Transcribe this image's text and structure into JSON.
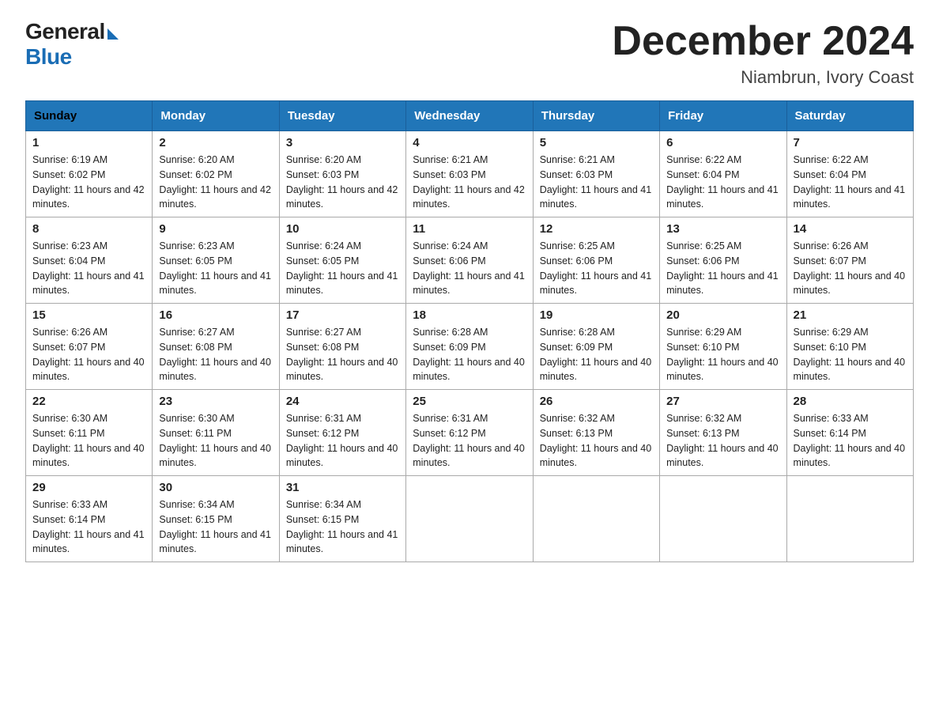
{
  "header": {
    "logo_general": "General",
    "logo_blue": "Blue",
    "month_year": "December 2024",
    "location": "Niambrun, Ivory Coast"
  },
  "days_of_week": [
    "Sunday",
    "Monday",
    "Tuesday",
    "Wednesday",
    "Thursday",
    "Friday",
    "Saturday"
  ],
  "weeks": [
    [
      {
        "day": "1",
        "sunrise": "6:19 AM",
        "sunset": "6:02 PM",
        "daylight": "11 hours and 42 minutes."
      },
      {
        "day": "2",
        "sunrise": "6:20 AM",
        "sunset": "6:02 PM",
        "daylight": "11 hours and 42 minutes."
      },
      {
        "day": "3",
        "sunrise": "6:20 AM",
        "sunset": "6:03 PM",
        "daylight": "11 hours and 42 minutes."
      },
      {
        "day": "4",
        "sunrise": "6:21 AM",
        "sunset": "6:03 PM",
        "daylight": "11 hours and 42 minutes."
      },
      {
        "day": "5",
        "sunrise": "6:21 AM",
        "sunset": "6:03 PM",
        "daylight": "11 hours and 41 minutes."
      },
      {
        "day": "6",
        "sunrise": "6:22 AM",
        "sunset": "6:04 PM",
        "daylight": "11 hours and 41 minutes."
      },
      {
        "day": "7",
        "sunrise": "6:22 AM",
        "sunset": "6:04 PM",
        "daylight": "11 hours and 41 minutes."
      }
    ],
    [
      {
        "day": "8",
        "sunrise": "6:23 AM",
        "sunset": "6:04 PM",
        "daylight": "11 hours and 41 minutes."
      },
      {
        "day": "9",
        "sunrise": "6:23 AM",
        "sunset": "6:05 PM",
        "daylight": "11 hours and 41 minutes."
      },
      {
        "day": "10",
        "sunrise": "6:24 AM",
        "sunset": "6:05 PM",
        "daylight": "11 hours and 41 minutes."
      },
      {
        "day": "11",
        "sunrise": "6:24 AM",
        "sunset": "6:06 PM",
        "daylight": "11 hours and 41 minutes."
      },
      {
        "day": "12",
        "sunrise": "6:25 AM",
        "sunset": "6:06 PM",
        "daylight": "11 hours and 41 minutes."
      },
      {
        "day": "13",
        "sunrise": "6:25 AM",
        "sunset": "6:06 PM",
        "daylight": "11 hours and 41 minutes."
      },
      {
        "day": "14",
        "sunrise": "6:26 AM",
        "sunset": "6:07 PM",
        "daylight": "11 hours and 40 minutes."
      }
    ],
    [
      {
        "day": "15",
        "sunrise": "6:26 AM",
        "sunset": "6:07 PM",
        "daylight": "11 hours and 40 minutes."
      },
      {
        "day": "16",
        "sunrise": "6:27 AM",
        "sunset": "6:08 PM",
        "daylight": "11 hours and 40 minutes."
      },
      {
        "day": "17",
        "sunrise": "6:27 AM",
        "sunset": "6:08 PM",
        "daylight": "11 hours and 40 minutes."
      },
      {
        "day": "18",
        "sunrise": "6:28 AM",
        "sunset": "6:09 PM",
        "daylight": "11 hours and 40 minutes."
      },
      {
        "day": "19",
        "sunrise": "6:28 AM",
        "sunset": "6:09 PM",
        "daylight": "11 hours and 40 minutes."
      },
      {
        "day": "20",
        "sunrise": "6:29 AM",
        "sunset": "6:10 PM",
        "daylight": "11 hours and 40 minutes."
      },
      {
        "day": "21",
        "sunrise": "6:29 AM",
        "sunset": "6:10 PM",
        "daylight": "11 hours and 40 minutes."
      }
    ],
    [
      {
        "day": "22",
        "sunrise": "6:30 AM",
        "sunset": "6:11 PM",
        "daylight": "11 hours and 40 minutes."
      },
      {
        "day": "23",
        "sunrise": "6:30 AM",
        "sunset": "6:11 PM",
        "daylight": "11 hours and 40 minutes."
      },
      {
        "day": "24",
        "sunrise": "6:31 AM",
        "sunset": "6:12 PM",
        "daylight": "11 hours and 40 minutes."
      },
      {
        "day": "25",
        "sunrise": "6:31 AM",
        "sunset": "6:12 PM",
        "daylight": "11 hours and 40 minutes."
      },
      {
        "day": "26",
        "sunrise": "6:32 AM",
        "sunset": "6:13 PM",
        "daylight": "11 hours and 40 minutes."
      },
      {
        "day": "27",
        "sunrise": "6:32 AM",
        "sunset": "6:13 PM",
        "daylight": "11 hours and 40 minutes."
      },
      {
        "day": "28",
        "sunrise": "6:33 AM",
        "sunset": "6:14 PM",
        "daylight": "11 hours and 40 minutes."
      }
    ],
    [
      {
        "day": "29",
        "sunrise": "6:33 AM",
        "sunset": "6:14 PM",
        "daylight": "11 hours and 41 minutes."
      },
      {
        "day": "30",
        "sunrise": "6:34 AM",
        "sunset": "6:15 PM",
        "daylight": "11 hours and 41 minutes."
      },
      {
        "day": "31",
        "sunrise": "6:34 AM",
        "sunset": "6:15 PM",
        "daylight": "11 hours and 41 minutes."
      },
      null,
      null,
      null,
      null
    ]
  ]
}
